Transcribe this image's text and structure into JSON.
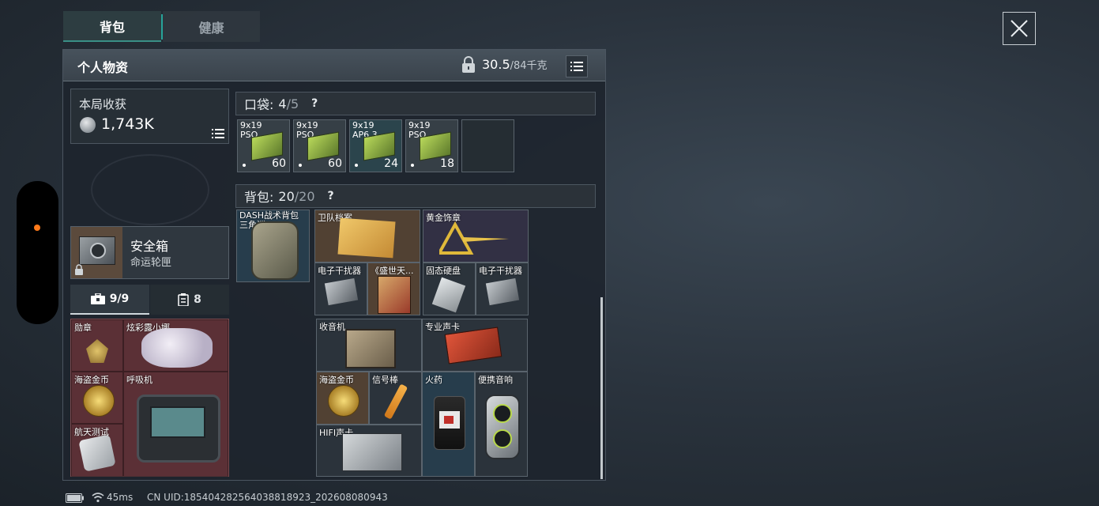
{
  "tabs": [
    {
      "label": "背包",
      "active": true
    },
    {
      "label": "健康",
      "active": false
    }
  ],
  "header": {
    "title": "个人物资",
    "weight_value": "30.5",
    "weight_cap": "/84千克"
  },
  "earnings": {
    "label": "本局收获",
    "value": "1,743K"
  },
  "safe_box": {
    "title": "安全箱",
    "subtitle": "命运轮匣"
  },
  "container_tabs": [
    {
      "label": "9/9",
      "icon": "toolbox-icon"
    },
    {
      "label": "8",
      "icon": "clipboard-icon"
    }
  ],
  "secure_items": [
    {
      "label": "勋章"
    },
    {
      "label": "炫彩露小娜"
    },
    {
      "label": "海盗金币"
    },
    {
      "label": "呼吸机"
    },
    {
      "label": "航天测试"
    }
  ],
  "pocket": {
    "label": "口袋:",
    "used": "4",
    "total": "/5",
    "help": "?",
    "ammo": [
      {
        "caliber": "9x19",
        "type": "PSO",
        "count": "60"
      },
      {
        "caliber": "9x19",
        "type": "PSO",
        "count": "60"
      },
      {
        "caliber": "9x19",
        "type": "AP6.3",
        "count": "24"
      },
      {
        "caliber": "9x19",
        "type": "PSO",
        "count": "18"
      }
    ]
  },
  "backpack": {
    "label": "背包:",
    "used": "20",
    "total": "/20",
    "help": "?",
    "bag_name": "DASH战术背包三角洲",
    "items": [
      {
        "label": "卫队档案"
      },
      {
        "label": "黄金饰章"
      },
      {
        "label": "电子干扰器"
      },
      {
        "label": "《盛世天..."
      },
      {
        "label": "固态硬盘"
      },
      {
        "label": "电子干扰器"
      },
      {
        "label": "收音机"
      },
      {
        "label": "专业声卡"
      },
      {
        "label": "海盗金币"
      },
      {
        "label": "信号棒"
      },
      {
        "label": "火药"
      },
      {
        "label": "便携音响"
      },
      {
        "label": "HIFI声卡"
      }
    ]
  },
  "status": {
    "ping": "45ms",
    "uid": "CN UID:18540428256403881892​3_202608080943"
  }
}
